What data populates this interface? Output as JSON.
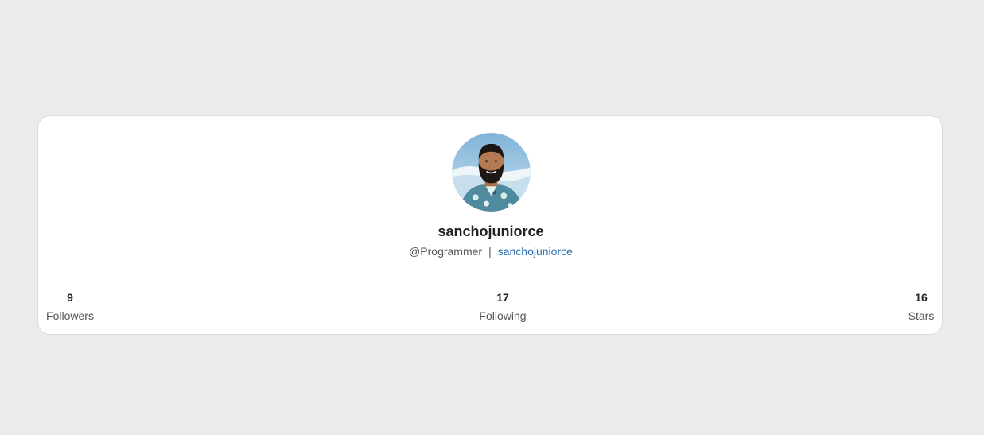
{
  "profile": {
    "username": "sanchojuniorce",
    "role": "@Programmer",
    "separator": "|",
    "link_text": "sanchojuniorce"
  },
  "stats": [
    {
      "value": "9",
      "label": "Followers"
    },
    {
      "value": "17",
      "label": "Following"
    },
    {
      "value": "16",
      "label": "Stars"
    }
  ],
  "colors": {
    "background": "#ebebeb",
    "card": "#ffffff",
    "link": "#2a6db0"
  }
}
